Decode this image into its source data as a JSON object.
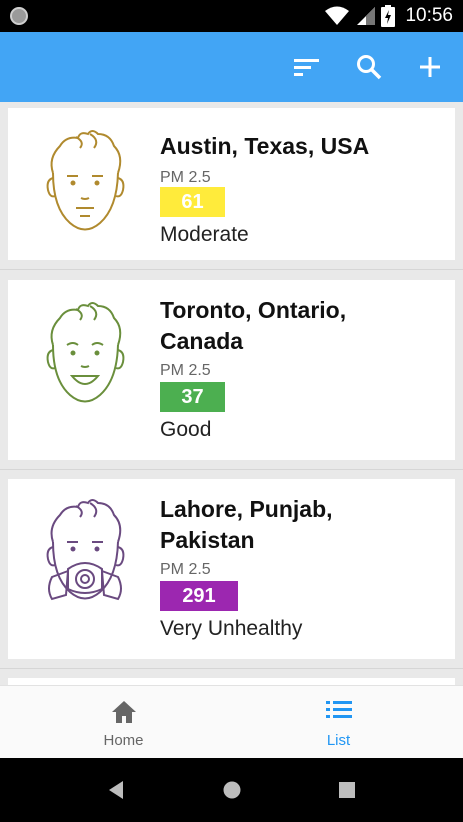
{
  "status_bar": {
    "time": "10:56"
  },
  "app_bar": {
    "actions": [
      "sort-icon",
      "search-icon",
      "add-icon"
    ]
  },
  "locations": [
    {
      "city_line1": "Austin, Texas, USA",
      "city_line2": "",
      "pm_label": "PM 2.5",
      "value": "61",
      "level": "Moderate",
      "badge_color": "#ffeb3b",
      "face_color": "#b08a2e",
      "face": "neutral-face-icon"
    },
    {
      "city_line1": "Toronto, Ontario,",
      "city_line2": "Canada",
      "pm_label": "PM 2.5",
      "value": "37",
      "level": "Good",
      "badge_color": "#4caf50",
      "face_color": "#6a8f3c",
      "face": "smiling-face-icon"
    },
    {
      "city_line1": "Lahore, Punjab,",
      "city_line2": "Pakistan",
      "pm_label": "PM 2.5",
      "value": "291",
      "level": "Very Unhealthy",
      "badge_color": "#9c27b0",
      "face_color": "#6a4a80",
      "face": "gas-mask-face-icon"
    }
  ],
  "bottom_nav": {
    "home_label": "Home",
    "list_label": "List",
    "active": "List",
    "active_color": "#2196f3",
    "inactive_color": "#666666"
  }
}
